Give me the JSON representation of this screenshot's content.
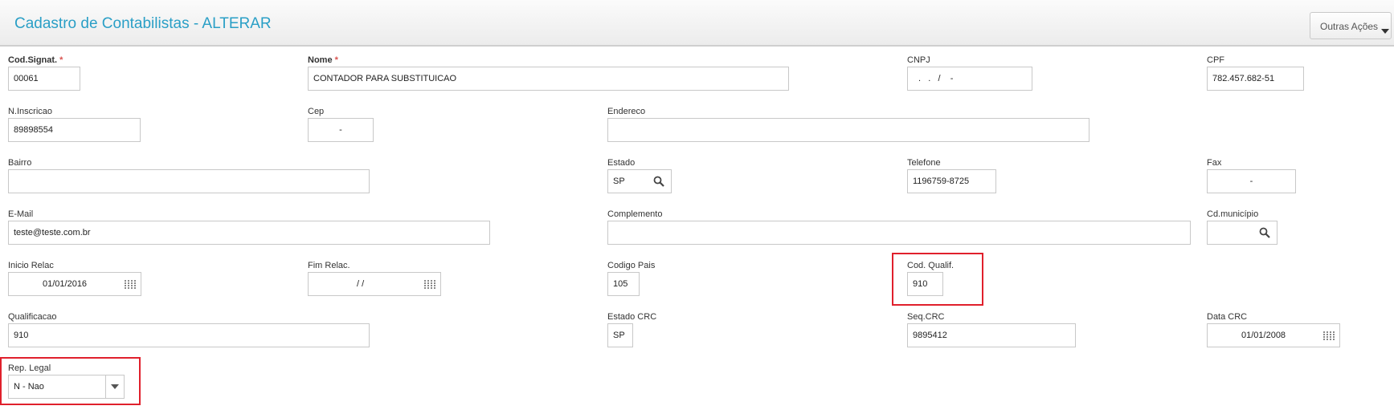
{
  "header": {
    "title": "Cadastro de Contabilistas - ALTERAR",
    "actions_label": "Outras Ações"
  },
  "fields": {
    "cod_signat": {
      "label": "Cod.Signat.",
      "value": "00061",
      "required": "*"
    },
    "nome": {
      "label": "Nome",
      "value": "CONTADOR PARA SUBSTITUICAO",
      "required": "*"
    },
    "cnpj": {
      "label": "CNPJ",
      "value": " .   .   /    -"
    },
    "cpf": {
      "label": "CPF",
      "value": "782.457.682-51"
    },
    "n_inscricao": {
      "label": "N.Inscricao",
      "value": "89898554"
    },
    "cep": {
      "label": "Cep",
      "value": "-"
    },
    "endereco": {
      "label": "Endereco",
      "value": ""
    },
    "bairro": {
      "label": "Bairro",
      "value": ""
    },
    "estado": {
      "label": "Estado",
      "value": "SP"
    },
    "telefone": {
      "label": "Telefone",
      "value": "1196759-8725"
    },
    "fax": {
      "label": "Fax",
      "value": "-"
    },
    "email": {
      "label": "E-Mail",
      "value": "teste@teste.com.br"
    },
    "complemento": {
      "label": "Complemento",
      "value": ""
    },
    "cd_municipio": {
      "label": "Cd.município",
      "value": ""
    },
    "inicio_relac": {
      "label": "Inicio Relac",
      "value": "01/01/2016"
    },
    "fim_relac": {
      "label": "Fim Relac.",
      "value": "/ /"
    },
    "codigo_pais": {
      "label": "Codigo Pais",
      "value": "105"
    },
    "cod_qualif": {
      "label": "Cod. Qualif.",
      "value": "910"
    },
    "qualificacao": {
      "label": "Qualificacao",
      "value": "910"
    },
    "estado_crc": {
      "label": "Estado CRC",
      "value": "SP"
    },
    "seq_crc": {
      "label": "Seq.CRC",
      "value": "9895412"
    },
    "data_crc": {
      "label": "Data CRC",
      "value": "01/01/2008"
    },
    "rep_legal": {
      "label": "Rep. Legal",
      "value": "N - Nao"
    }
  },
  "icons": {
    "lookup": "magnifier-icon",
    "date": "calendar-icon",
    "dropdown": "chevron-down-icon"
  },
  "colors": {
    "title": "#2a9fc6",
    "required": "#d9534f",
    "highlight": "#e0202c"
  }
}
